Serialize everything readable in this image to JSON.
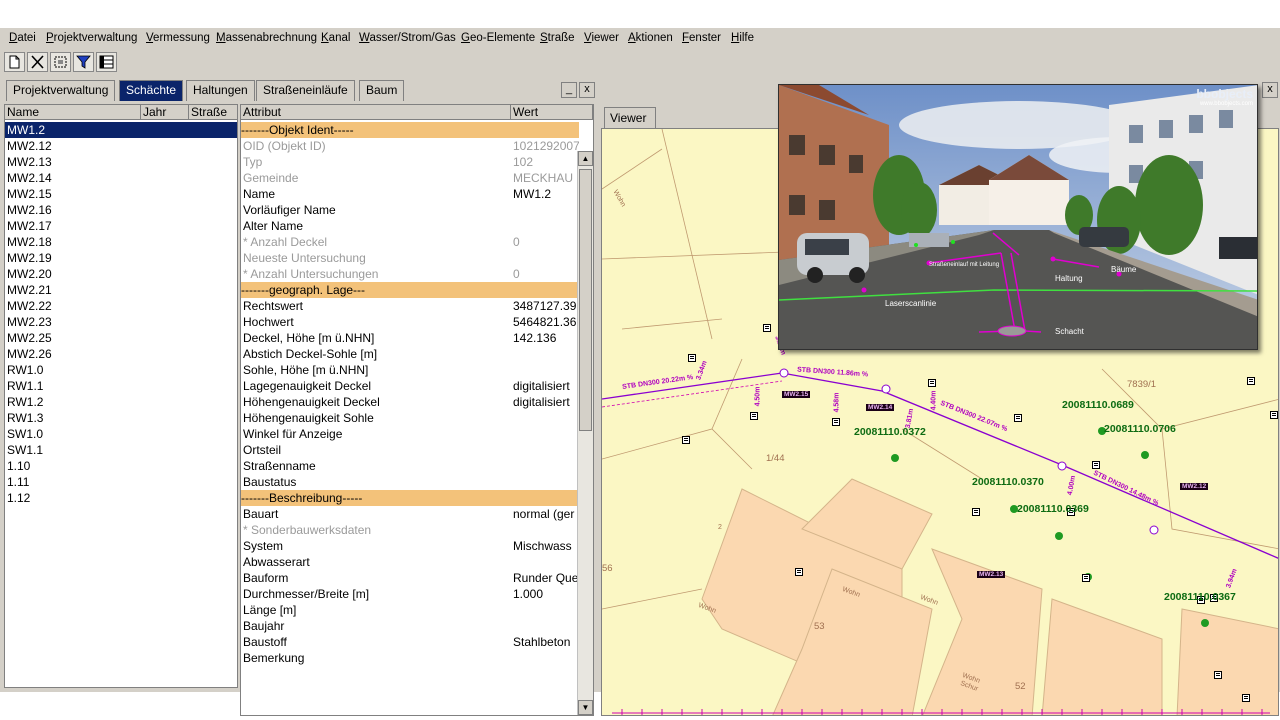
{
  "menu": [
    "Datei",
    "Projektverwaltung",
    "Vermessung",
    "Massenabrechnung",
    "Kanal",
    "Wasser/Strom/Gas",
    "Geo-Elemente",
    "Straße",
    "Viewer",
    "Aktionen",
    "Fenster",
    "Hilfe"
  ],
  "toolbar": [
    "new-document-icon",
    "close-icon",
    "select-area-icon",
    "filter-icon",
    "table-icon"
  ],
  "tabs": [
    "Projektverwaltung",
    "Schächte",
    "Haltungen",
    "Straßeneinläufe",
    "Baum"
  ],
  "active_tab": "Schächte",
  "panel_buttons": {
    "minimize": "_",
    "close": "x"
  },
  "list": {
    "columns": [
      "Name",
      "Jahr",
      "Straße"
    ],
    "rows": [
      "MW1.2",
      "MW2.12",
      "MW2.13",
      "MW2.14",
      "MW2.15",
      "MW2.16",
      "MW2.17",
      "MW2.18",
      "MW2.19",
      "MW2.20",
      "MW2.21",
      "MW2.22",
      "MW2.23",
      "MW2.25",
      "MW2.26",
      "RW1.0",
      "RW1.1",
      "RW1.2",
      "RW1.3",
      "SW1.0",
      "SW1.1",
      "1.10",
      "1.11",
      "1.12"
    ],
    "selected": "MW1.2"
  },
  "attributes": {
    "columns": [
      "Attribut",
      "Wert"
    ],
    "rows": [
      {
        "name": "-------Objekt Ident-----",
        "value": "",
        "section": true
      },
      {
        "name": "OID (Objekt ID)",
        "value": "1021292007",
        "grey": true
      },
      {
        "name": "Typ",
        "value": "102",
        "grey": true
      },
      {
        "name": "Gemeinde",
        "value": "MECKHAU",
        "grey": true
      },
      {
        "name": "Name",
        "value": "MW1.2"
      },
      {
        "name": "Vorläufiger Name",
        "value": ""
      },
      {
        "name": "Alter Name",
        "value": ""
      },
      {
        "name": "* Anzahl Deckel",
        "value": "0",
        "grey": true
      },
      {
        "name": "Neueste Untersuchung",
        "value": "",
        "grey": true
      },
      {
        "name": "* Anzahl Untersuchungen",
        "value": "0",
        "grey": true
      },
      {
        "name": "-------geograph. Lage---",
        "value": "",
        "section": true
      },
      {
        "name": "Rechtswert",
        "value": "3487127.39"
      },
      {
        "name": "Hochwert",
        "value": "5464821.36"
      },
      {
        "name": "Deckel, Höhe [m ü.NHN]",
        "value": "142.136"
      },
      {
        "name": "Abstich Deckel-Sohle [m]",
        "value": ""
      },
      {
        "name": "Sohle, Höhe  [m ü.NHN]",
        "value": ""
      },
      {
        "name": "Lagegenauigkeit Deckel",
        "value": "digitalisiert"
      },
      {
        "name": "Höhengenauigkeit Deckel",
        "value": "digitalisiert"
      },
      {
        "name": "Höhengenauigkeit Sohle",
        "value": ""
      },
      {
        "name": "Winkel für Anzeige",
        "value": ""
      },
      {
        "name": "Ortsteil",
        "value": ""
      },
      {
        "name": "Straßenname",
        "value": ""
      },
      {
        "name": "Baustatus",
        "value": ""
      },
      {
        "name": "-------Beschreibung-----",
        "value": "",
        "section": true
      },
      {
        "name": "Bauart",
        "value": "normal (ger"
      },
      {
        "name": "* Sonderbauwerksdaten",
        "value": "",
        "grey": true
      },
      {
        "name": "System",
        "value": "Mischwass"
      },
      {
        "name": "Abwasserart",
        "value": ""
      },
      {
        "name": "Bauform",
        "value": "Runder Que"
      },
      {
        "name": "Durchmesser/Breite [m]",
        "value": "1.000"
      },
      {
        "name": "Länge [m]",
        "value": ""
      },
      {
        "name": "Baujahr",
        "value": ""
      },
      {
        "name": "Baustoff",
        "value": "Stahlbeton"
      },
      {
        "name": "Bemerkung",
        "value": ""
      }
    ]
  },
  "viewer": {
    "tab": "Viewer",
    "close": "x",
    "photo": {
      "logo": "bbobjects",
      "logo_url": "www.bbobjects.com",
      "labels": {
        "einlauf": "Straßeneinlauf mit Leitung",
        "haltung": "Haltung",
        "baeume": "Bäume",
        "laser": "Laserscanlinie",
        "schacht": "Schacht"
      }
    },
    "map_labels": [
      "20081110.0689",
      "20081110.0706",
      "20081110.0372",
      "20081110.0370",
      "20081110.0369",
      "20081110.0367"
    ],
    "mw_tags": [
      "MW2.15",
      "MW2.14",
      "MW2.12",
      "MW2.13"
    ],
    "pipe_texts": [
      "STB DN300 20.22m %",
      "STB DN300 11.86m %",
      "STB DN300 22.07m %",
      "STB DN300 14.48m %"
    ],
    "depth_texts": [
      "4.50m",
      "4.58m",
      "4.40m",
      "3.81m",
      "4.00m",
      "3.94m",
      "3.34m",
      "3.14m"
    ],
    "parcel_texts": [
      "1/44",
      "53",
      "52",
      "7839/1",
      "2",
      "56",
      "Wohn",
      "Wohn",
      "Wohn",
      "Wohn",
      "Wohn",
      "Schur"
    ],
    "colors": {
      "pipe": "#b000c0",
      "tree": "#1f9a22",
      "mapBg": "#fbf7c4",
      "building": "#fbd8b0"
    }
  }
}
